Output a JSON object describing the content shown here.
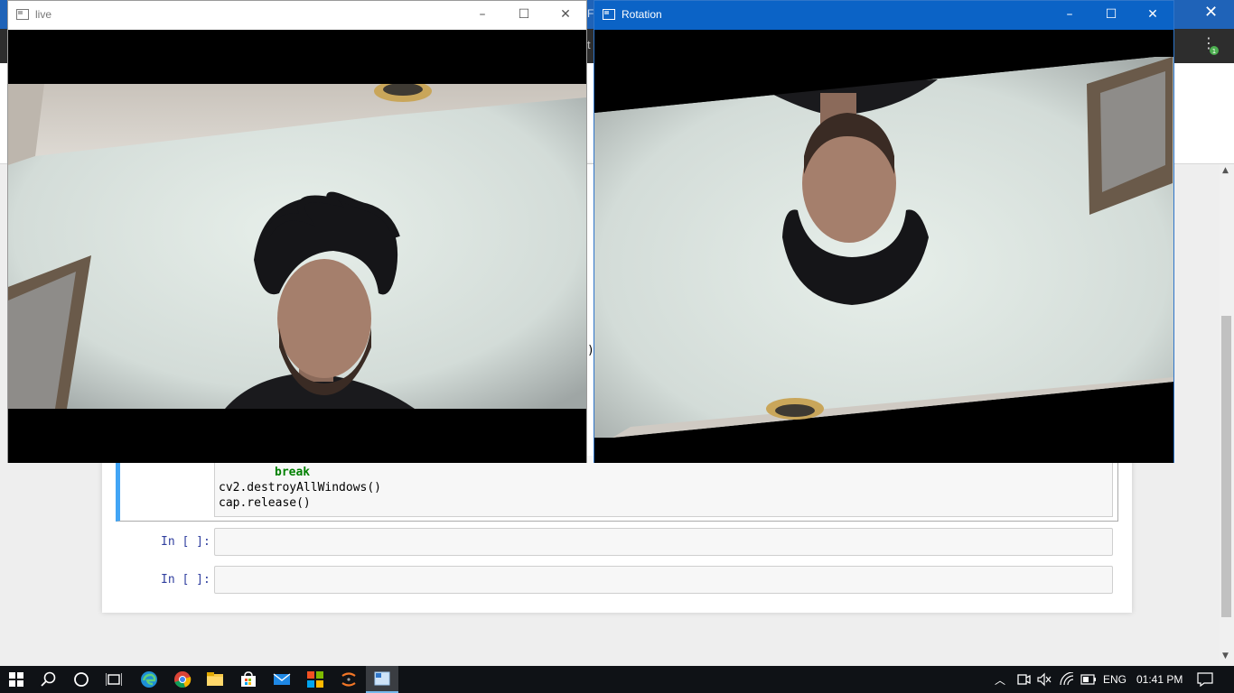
{
  "browser": {
    "tab_fragment": "Fa",
    "nav_fragment": "t",
    "notebook": {
      "code_lines": [
        "break",
        "cv2.destroyAllWindows()",
        "cap.release()"
      ],
      "stray_text": ")",
      "prompts": [
        "In [ ]:",
        "In [ ]:"
      ]
    }
  },
  "windows": {
    "live": {
      "title": "live",
      "controls": [
        "–",
        "☐",
        "✕"
      ]
    },
    "rotation": {
      "title": "Rotation",
      "controls": [
        "–",
        "☐",
        "✕"
      ]
    }
  },
  "taskbar": {
    "apps": [
      "start",
      "search",
      "cortana",
      "task-view",
      "edge",
      "chrome",
      "file-explorer",
      "store",
      "mail",
      "office",
      "jupyter",
      "opencv-window"
    ],
    "tray": {
      "language": "ENG",
      "time": "01:41 PM"
    }
  },
  "colors": {
    "taskbar": "#0f1216",
    "rotation_titlebar": "#0b63c6",
    "code_keyword": "#008000",
    "prompt": "#303f9f",
    "cell_accent": "#42a5f5"
  }
}
